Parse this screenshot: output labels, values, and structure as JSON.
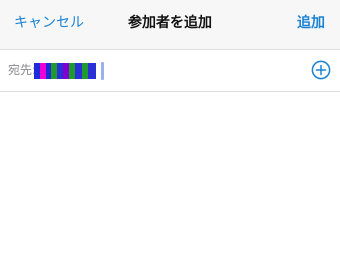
{
  "header": {
    "cancel_label": "キャンセル",
    "title": "参加者を追加",
    "add_label": "追加"
  },
  "recipient_field": {
    "label": "宛先:",
    "recipient_redacted": true,
    "add_icon": "plus-circle-icon"
  },
  "colors": {
    "accent": "#1a82d4",
    "header_bg": "#f7f7f8"
  }
}
